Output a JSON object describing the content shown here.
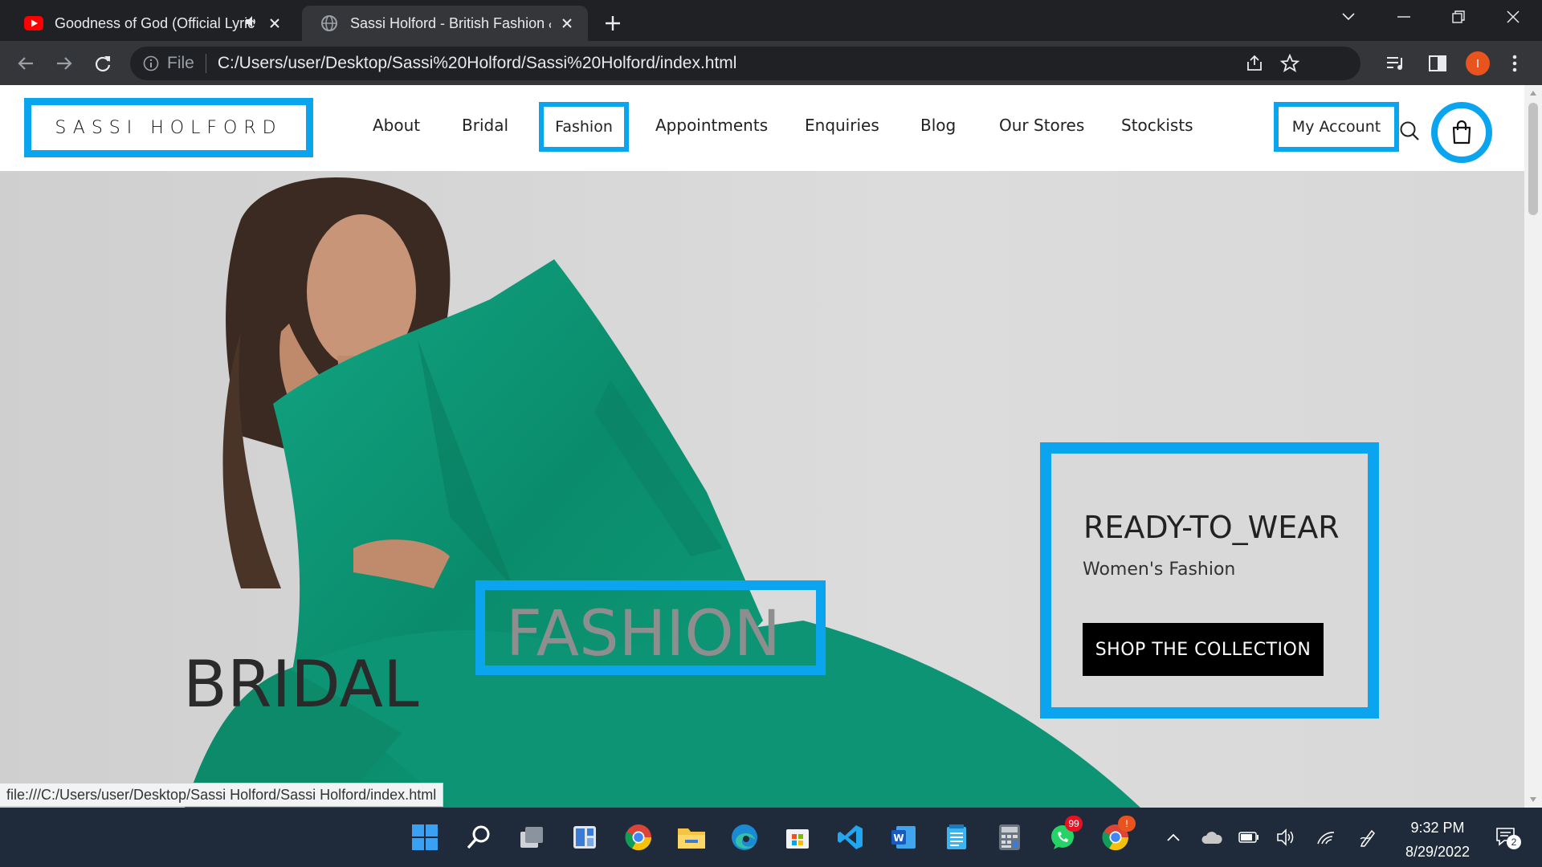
{
  "browser": {
    "tabs": [
      {
        "title": "Goodness of God (Official Lyric",
        "active": false,
        "icon": "youtube-icon"
      },
      {
        "title": "Sassi Holford - British Fashion & ",
        "active": true,
        "icon": "globe-icon"
      }
    ],
    "omnibox": {
      "scheme_label": "File",
      "url": "C:/Users/user/Desktop/Sassi%20Holford/Sassi%20Holford/index.html"
    },
    "profile_initial": "I",
    "status_url": "file:///C:/Users/user/Desktop/Sassi Holford/Sassi Holford/index.html"
  },
  "site": {
    "logo": "SASSI HOLFORD",
    "nav": [
      "About",
      "Bridal",
      "Fashion",
      "Appointments",
      "Enquiries",
      "Blog",
      "Our Stores",
      "Stockists"
    ],
    "account_label": "My Account",
    "hero": {
      "cta_title": "READY-TO_WEAR",
      "cta_subtitle": "Women's Fashion",
      "cta_button": "SHOP THE COLLECTION",
      "category_bridal": "BRIDAL",
      "category_fashion": "FASHION"
    }
  },
  "taskbar": {
    "whatsapp_badge": "99",
    "chrome_badge": "!",
    "time": "9:32 PM",
    "date": "8/29/2022",
    "notifications": "2"
  },
  "colors": {
    "highlight": "#0aa5ee",
    "suit": "#0e9c76",
    "chrome_bg": "#202124"
  }
}
